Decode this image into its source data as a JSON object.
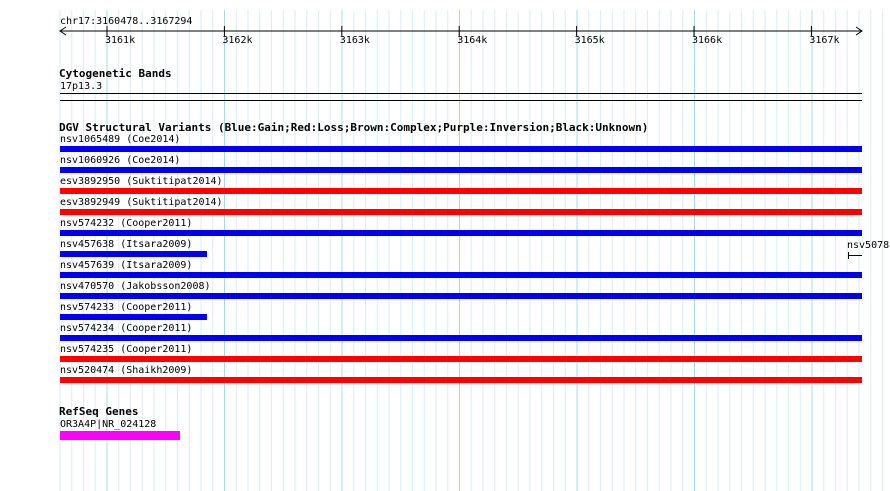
{
  "ruler": {
    "region": "chr17:3160478..3167294",
    "ticks": [
      "3161k",
      "3162k",
      "3163k",
      "3164k",
      "3165k",
      "3166k",
      "3167k"
    ]
  },
  "cytoband": {
    "title": "Cytogenetic Bands",
    "band": "17p13.3"
  },
  "dgv": {
    "title": "DGV Structural Variants (Blue:Gain;Red:Loss;Brown:Complex;Purple:Inversion;Black:Unknown)",
    "colors": {
      "gain": "#0000ee",
      "loss": "#ff0000"
    },
    "variants": [
      {
        "label": "nsv1065489 (Coe2014)",
        "type": "gain",
        "extent": "full"
      },
      {
        "label": "nsv1060926 (Coe2014)",
        "type": "gain",
        "extent": "full"
      },
      {
        "label": "esv3892950 (Suktitipat2014)",
        "type": "loss",
        "extent": "full"
      },
      {
        "label": "esv3892949 (Suktitipat2014)",
        "type": "loss",
        "extent": "full"
      },
      {
        "label": "nsv574232 (Cooper2011)",
        "type": "gain",
        "extent": "full"
      },
      {
        "label": "nsv457638 (Itsara2009)",
        "type": "gain",
        "extent": "partial"
      },
      {
        "label": "nsv457639 (Itsara2009)",
        "type": "gain",
        "extent": "full"
      },
      {
        "label": "nsv470570 (Jakobsson2008)",
        "type": "gain",
        "extent": "full"
      },
      {
        "label": "nsv574233 (Cooper2011)",
        "type": "gain",
        "extent": "partial"
      },
      {
        "label": "nsv574234 (Cooper2011)",
        "type": "gain",
        "extent": "full"
      },
      {
        "label": "nsv574235 (Cooper2011)",
        "type": "loss",
        "extent": "full"
      },
      {
        "label": "nsv520474 (Shaikh2009)",
        "type": "loss",
        "extent": "full"
      }
    ],
    "edge_label": "nsv5078"
  },
  "refseq": {
    "title": "RefSeq Genes",
    "gene": "OR3A4P|NR_024128",
    "color": "#ff00ff"
  }
}
